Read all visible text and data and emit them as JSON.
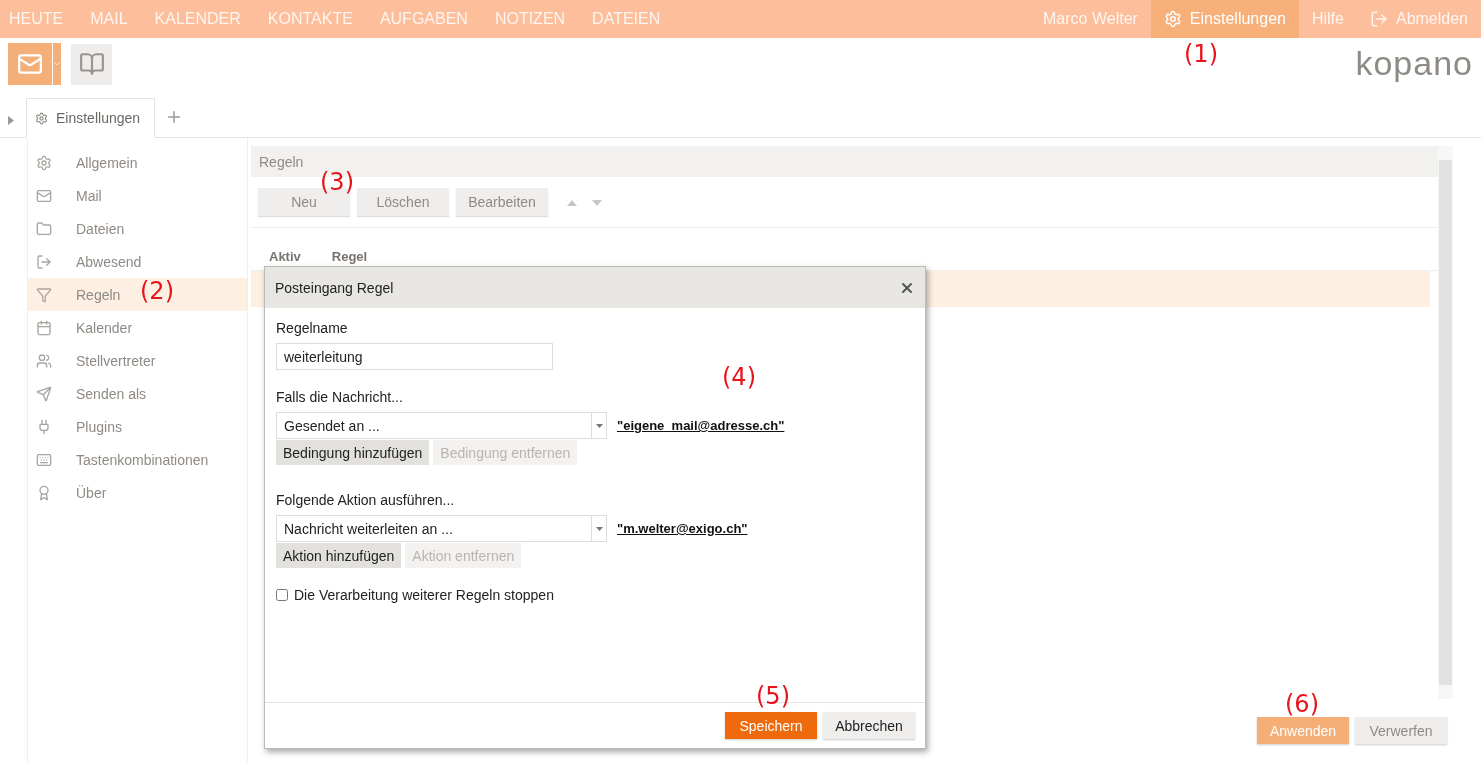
{
  "top_nav": {
    "modules": [
      {
        "label": "HEUTE",
        "selected": false
      },
      {
        "label": "MAIL",
        "selected": false
      },
      {
        "label": "KALENDER",
        "selected": false
      },
      {
        "label": "KONTAKTE",
        "selected": false
      },
      {
        "label": "AUFGABEN",
        "selected": false
      },
      {
        "label": "NOTIZEN",
        "selected": false
      },
      {
        "label": "DATEIEN",
        "selected": false
      }
    ],
    "user": "Marco Welter",
    "right_items": [
      {
        "label": "Einstellungen",
        "kind": "settings",
        "selected": true
      },
      {
        "label": "Hilfe",
        "kind": "plain",
        "selected": false
      },
      {
        "label": "Abmelden",
        "kind": "logout",
        "selected": false
      }
    ]
  },
  "logo": "kopano",
  "tabs": [
    {
      "label": "Einstellungen",
      "selected": true
    }
  ],
  "sidebar": {
    "items": [
      {
        "label": "Allgemein",
        "selected": false
      },
      {
        "label": "Mail",
        "selected": false
      },
      {
        "label": "Dateien",
        "selected": false
      },
      {
        "label": "Abwesend",
        "selected": false
      },
      {
        "label": "Regeln",
        "selected": true
      },
      {
        "label": "Kalender",
        "selected": false
      },
      {
        "label": "Stellvertreter",
        "selected": false
      },
      {
        "label": "Senden als",
        "selected": false
      },
      {
        "label": "Plugins",
        "selected": false
      },
      {
        "label": "Tastenkombinationen",
        "selected": false
      },
      {
        "label": "Über",
        "selected": false
      }
    ]
  },
  "rules_panel": {
    "title": "Regeln",
    "buttons": [
      "Neu",
      "Löschen",
      "Bearbeiten"
    ],
    "columns": [
      "Aktiv",
      "Regel"
    ],
    "rows": [
      {
        "selected": true
      }
    ]
  },
  "dialog": {
    "title": "Posteingang Regel",
    "name_label": "Regelname",
    "name_value": "weiterleitung",
    "condition_label": "Falls die Nachricht...",
    "condition_select": "Gesendet an ...",
    "condition_value": "\"eigene_mail@adresse.ch\"",
    "condition_buttons": [
      {
        "label": "Bedingung hinzufügen",
        "disabled": false
      },
      {
        "label": "Bedingung entfernen",
        "disabled": true
      }
    ],
    "action_label": "Folgende Aktion ausführen...",
    "action_select": "Nachricht weiterleiten an ...",
    "action_value": "\"m.welter@exigo.ch\"",
    "action_buttons": [
      {
        "label": "Aktion hinzufügen",
        "disabled": false
      },
      {
        "label": "Aktion entfernen",
        "disabled": true
      }
    ],
    "stop_checkbox": {
      "label": "Die Verarbeitung weiterer Regeln stoppen",
      "checked": false
    },
    "footer_buttons": [
      {
        "label": "Speichern",
        "kind": "primary"
      },
      {
        "label": "Abbrechen",
        "kind": "secondary"
      }
    ]
  },
  "footer_buttons": [
    {
      "label": "Anwenden",
      "kind": "primary"
    },
    {
      "label": "Verwerfen",
      "kind": "secondary"
    }
  ],
  "callouts": [
    "(1)",
    "(2)",
    "(3)",
    "(4)",
    "(5)",
    "(6)"
  ]
}
